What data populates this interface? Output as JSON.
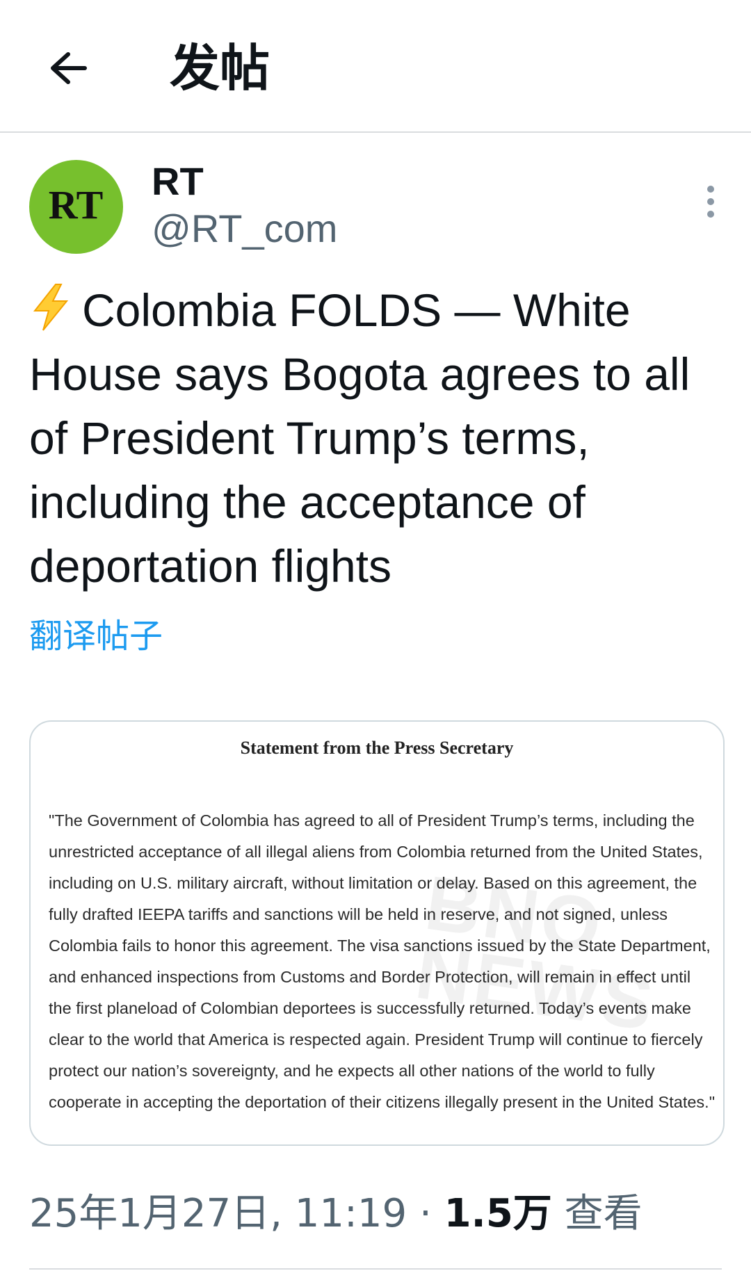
{
  "header": {
    "back_icon": "arrow-left-icon",
    "title": "发帖"
  },
  "author": {
    "avatar_text": "RT",
    "avatar_color": "#77c02d",
    "display_name": "RT",
    "handle": "@RT_com",
    "more_icon": "more-vertical-icon"
  },
  "post": {
    "emoji_icon": "lightning-bolt-icon",
    "text": "Colombia FOLDS — White House says Bogota agrees to all of President Trump’s terms, including the acceptance of deportation flights",
    "translate_label": "翻译帖子"
  },
  "media": {
    "statement_title": "Statement from the Press Secretary",
    "statement_body": "\"The Government of Colombia has agreed to all of President Trump’s terms, including the unrestricted acceptance of all illegal aliens from Colombia returned from the United States, including on U.S. military aircraft, without limitation or delay. Based on this agreement, the fully drafted IEEPA tariffs and sanctions will be held in reserve, and not signed, unless Colombia fails to honor this agreement. The visa sanctions issued by the State Department, and enhanced inspections from Customs and Border Protection, will remain in effect until the first planeload of Colombian deportees is successfully returned. Today’s events make clear to the world that America is respected again. President Trump will continue to fiercely protect our nation’s sovereignty, and he expects all other nations of the world to fully cooperate in accepting the deportation of their citizens illegally present in the United States.\"",
    "watermark": "BNO NEWS"
  },
  "meta": {
    "datetime": "25年1月27日, 11:19",
    "separator": "·",
    "views_count": "1.5万",
    "views_label": "查看"
  },
  "colors": {
    "link": "#1d9bf0",
    "secondary_text": "#536471",
    "primary_text": "#0f1419"
  }
}
